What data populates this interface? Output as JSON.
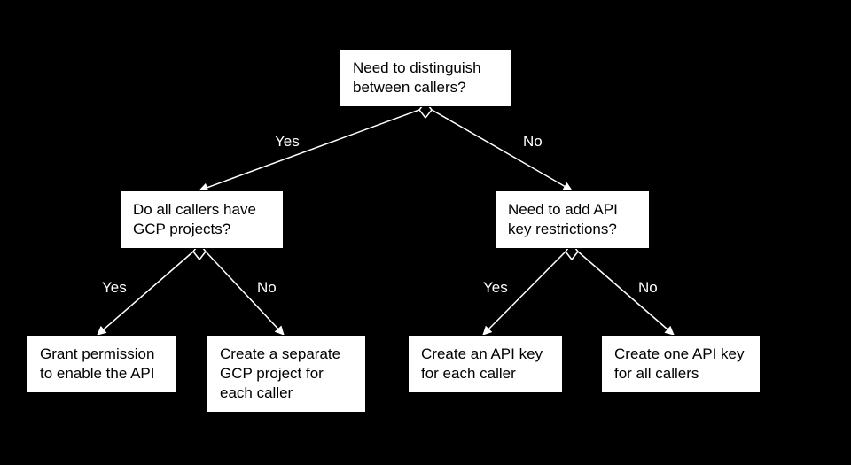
{
  "root": {
    "text": "Need to distinguish between callers?"
  },
  "left1": {
    "text": "Do all callers have GCP projects?"
  },
  "right1": {
    "text": "Need to add API key restrictions?"
  },
  "leaf_ll": {
    "text": "Grant permission to enable the API"
  },
  "leaf_lr": {
    "text": "Create a separate GCP project for each caller"
  },
  "leaf_rl": {
    "text": "Create an API key for each caller"
  },
  "leaf_rr": {
    "text": "Create one API key for all callers"
  },
  "edges": {
    "root_left": "Yes",
    "root_right": "No",
    "left1_l": "Yes",
    "left1_r": "No",
    "right1_l": "Yes",
    "right1_r": "No"
  }
}
